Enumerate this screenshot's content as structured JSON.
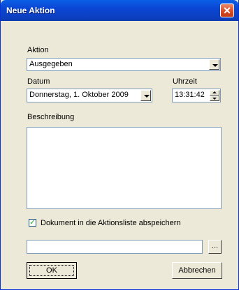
{
  "window": {
    "title": "Neue Aktion",
    "close_glyph": "✕"
  },
  "aktion": {
    "label": "Aktion",
    "value": "Ausgegeben"
  },
  "datum": {
    "label": "Datum",
    "value": "Donnerstag,  1.  Oktober  2009"
  },
  "uhrzeit": {
    "label": "Uhrzeit",
    "value": "13:31:42"
  },
  "beschreibung": {
    "label": "Beschreibung",
    "value": ""
  },
  "checkbox": {
    "label": "Dokument in die Aktionsliste abspeichern",
    "checked": true,
    "mark": "✓"
  },
  "path": {
    "value": "",
    "browse_label": "..."
  },
  "buttons": {
    "ok": "OK",
    "cancel": "Abbrechen"
  }
}
